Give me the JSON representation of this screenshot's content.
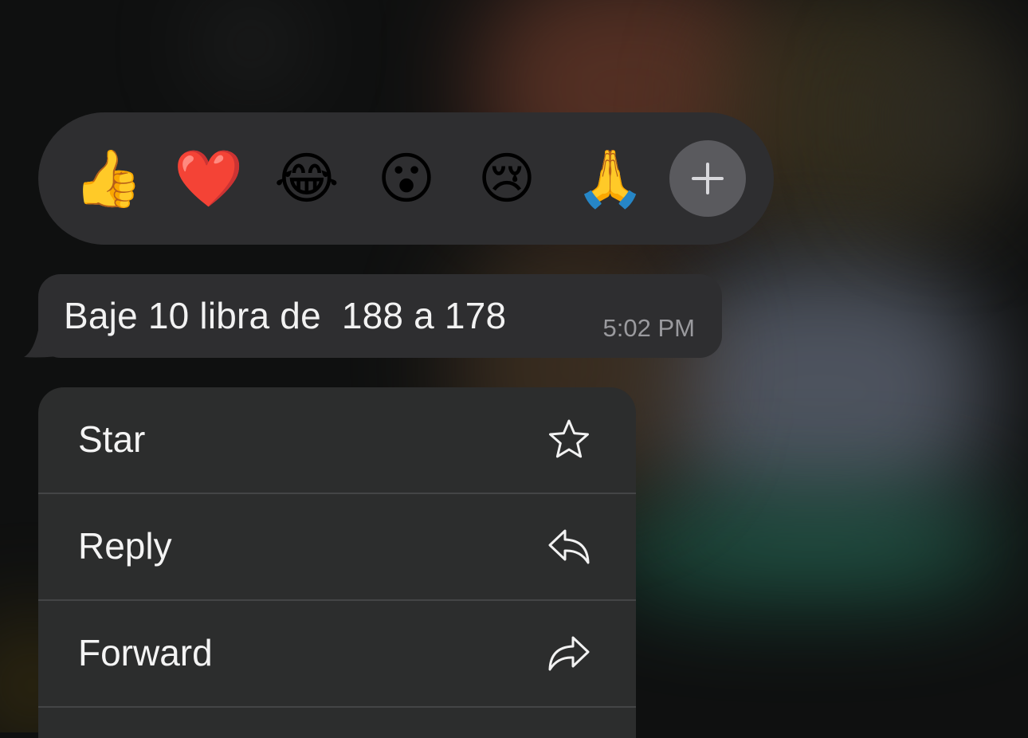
{
  "reactions": {
    "emojis": [
      {
        "char": "👍",
        "name": "thumbs-up"
      },
      {
        "char": "❤️",
        "name": "red-heart"
      },
      {
        "char": "😂",
        "name": "tears-of-joy"
      },
      {
        "char": "😮",
        "name": "surprised-face"
      },
      {
        "char": "😢",
        "name": "crying-face"
      },
      {
        "char": "🙏",
        "name": "folded-hands"
      }
    ],
    "more_icon": "plus-icon"
  },
  "message": {
    "text": "Baje 10 libra de  188 a 178",
    "time": "5:02 PM"
  },
  "menu": {
    "items": [
      {
        "label": "Star",
        "icon": "star-icon"
      },
      {
        "label": "Reply",
        "icon": "reply-icon"
      },
      {
        "label": "Forward",
        "icon": "forward-icon"
      }
    ]
  },
  "colors": {
    "surface": "#2e2e30",
    "menu_surface": "#2c2d2d",
    "text": "#f2f2f2",
    "secondary_text": "#9a9a9e",
    "add_button": "#5a5a5e"
  }
}
